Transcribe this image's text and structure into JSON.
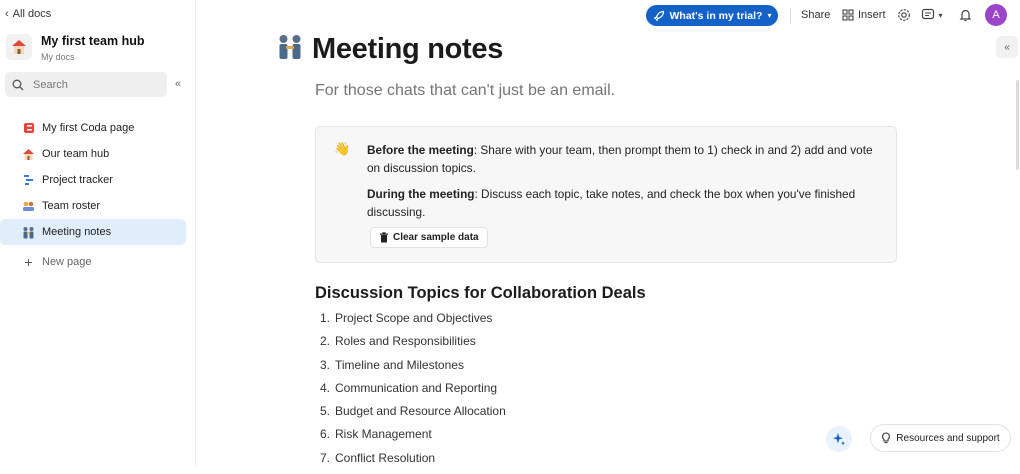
{
  "sidebar": {
    "back_label": "All docs",
    "doc_title": "My first team hub",
    "doc_subtitle": "My docs",
    "search_placeholder": "Search",
    "items": [
      {
        "label": "My first Coda page",
        "icon": "coda-page-icon"
      },
      {
        "label": "Our team hub",
        "icon": "house-icon"
      },
      {
        "label": "Project tracker",
        "icon": "gantt-icon"
      },
      {
        "label": "Team roster",
        "icon": "people-icon"
      },
      {
        "label": "Meeting notes",
        "icon": "meeting-people-icon",
        "active": true
      }
    ],
    "new_page_label": "New page"
  },
  "topbar": {
    "trial_label": "What's in my trial?",
    "share_label": "Share",
    "insert_label": "Insert",
    "avatar_initial": "A"
  },
  "page": {
    "title": "Meeting notes",
    "subtitle": "For those chats that can't just be an email.",
    "callout": {
      "before_bold": "Before the meeting",
      "before_text": ": Share with your team, then prompt them to 1) check in and 2) add and vote on discussion topics.",
      "during_bold": "During the meeting",
      "during_text": ": Discuss each topic, take notes, and check the box when you've finished discussing.",
      "clear_label": "Clear sample data"
    },
    "section_title": "Discussion Topics for Collaboration Deals",
    "topics": [
      "Project Scope and Objectives",
      "Roles and Responsibilities",
      "Timeline and Milestones",
      "Communication and Reporting",
      "Budget and Resource Allocation",
      "Risk Management",
      "Conflict Resolution"
    ]
  },
  "footer": {
    "support_label": "Resources and support"
  },
  "colors": {
    "accent": "#1462c7",
    "active_item": "#dfeefa",
    "avatar": "#9b45c8"
  }
}
